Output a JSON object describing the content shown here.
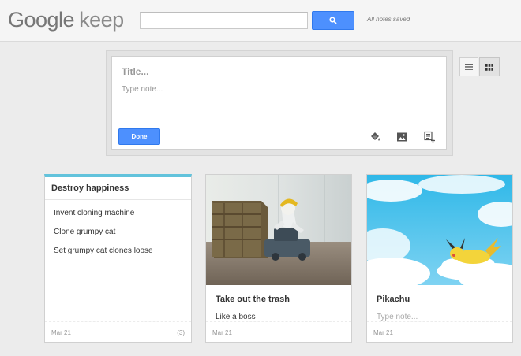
{
  "header": {
    "logo_brand": "Google",
    "logo_product": "keep",
    "search_placeholder": "",
    "status": "All notes saved"
  },
  "composer": {
    "title_placeholder": "Title...",
    "body_placeholder": "Type note...",
    "done_label": "Done"
  },
  "view": {
    "list_icon": "list-view-icon",
    "grid_icon": "grid-view-icon",
    "selected": "grid"
  },
  "notes": [
    {
      "title": "Destroy happiness",
      "items": [
        "Invent cloning machine",
        "Clone grumpy cat",
        "Set grumpy cat clones loose"
      ],
      "date": "Mar 21",
      "count": "(3)",
      "accent": "#62c3dc"
    },
    {
      "title": "Take out the trash",
      "body": "Like a boss",
      "date": "Mar 21",
      "image": "figurine-pushing-crate"
    },
    {
      "title": "Pikachu",
      "body": "Type note...",
      "date": "Mar 21",
      "image": "pikachu-on-cloud"
    }
  ],
  "colors": {
    "accent_blue": "#4d90fe",
    "background": "#ececec"
  }
}
